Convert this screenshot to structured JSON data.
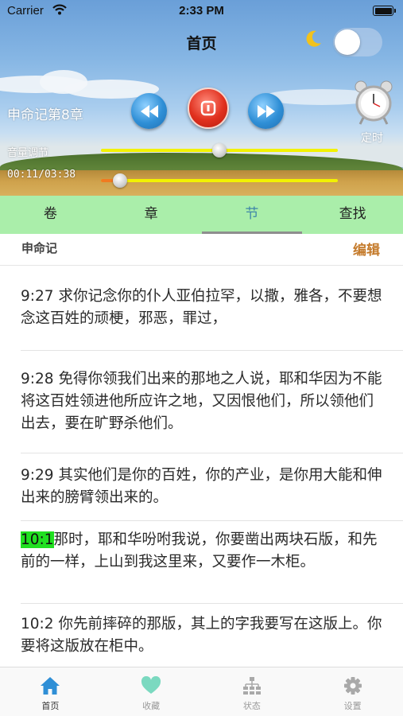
{
  "status_bar": {
    "carrier": "Carrier",
    "time": "2:33 PM"
  },
  "header": {
    "title": "首页",
    "chapter": "申命记第8章",
    "timer_label": "定时",
    "volume_label": "音量调节",
    "progress_time": "00:11/03:38",
    "volume_level": 0.5,
    "progress_level": 0.08,
    "night_mode": false
  },
  "segments": [
    "卷",
    "章",
    "节",
    "查找"
  ],
  "active_segment": 2,
  "book": {
    "name": "申命记",
    "edit_label": "编辑"
  },
  "verses": [
    {
      "ref": "9:27",
      "text": "求你记念你的仆人亚伯拉罕，以撒，雅各，不要想念这百姓的顽梗，邪恶，罪过，",
      "highlight": false
    },
    {
      "ref": "9:28",
      "text": "免得你领我们出来的那地之人说，耶和华因为不能将这百姓领进他所应许之地，又因恨他们，所以领他们出去，要在旷野杀他们。",
      "highlight": false
    },
    {
      "ref": "9:29",
      "text": "其实他们是你的百姓，你的产业，是你用大能和伸出来的膀臂领出来的。",
      "highlight": false
    },
    {
      "ref": "10:1",
      "text": "那时，耶和华吩咐我说，你要凿出两块石版，和先前的一样，上山到我这里来，又要作一木柜。",
      "highlight": true
    },
    {
      "ref": "10:2",
      "text": "你先前摔碎的那版，其上的字我要写在这版上。你要将这版放在柜中。",
      "highlight": false
    }
  ],
  "tab_bar": [
    {
      "label": "首页",
      "icon": "home-icon",
      "active": true
    },
    {
      "label": "收藏",
      "icon": "heart-icon",
      "active": false
    },
    {
      "label": "状态",
      "icon": "hierarchy-icon",
      "active": false
    },
    {
      "label": "设置",
      "icon": "gear-icon",
      "active": false
    }
  ],
  "colors": {
    "segment_bg": "#aaeeaa",
    "active_segment": "#3f86a8",
    "edit": "#c47a2a",
    "highlight": "#21e021",
    "tab_active": "#2f8fd6"
  }
}
